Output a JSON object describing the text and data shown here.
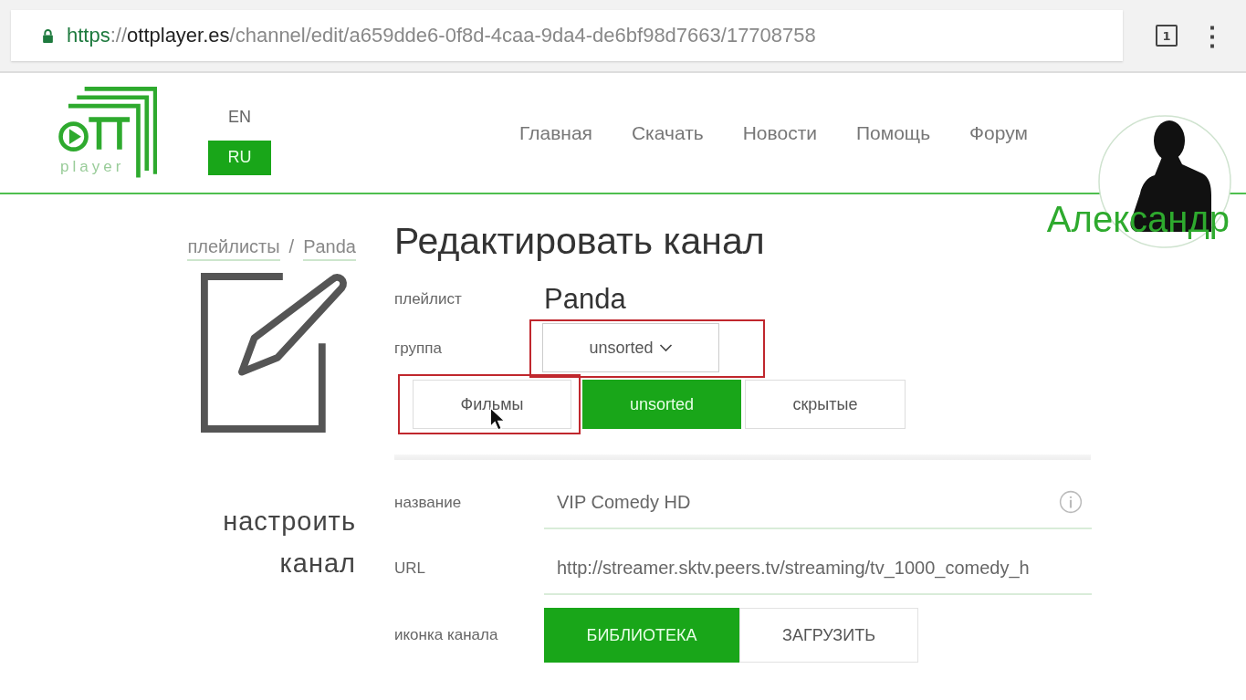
{
  "browser": {
    "url_scheme": "https",
    "url_sep": "://",
    "url_host": "ottplayer.es",
    "url_path": "/channel/edit/a659dde6-0f8d-4caa-9da4-de6bf98d7663/17708758",
    "tab_count": "1",
    "menu_glyph": "⋮"
  },
  "header": {
    "logo_text": "player",
    "languages": [
      {
        "label": "EN",
        "selected": false
      },
      {
        "label": "RU",
        "selected": true
      }
    ],
    "nav": [
      "Главная",
      "Скачать",
      "Новости",
      "Помощь",
      "Форум"
    ],
    "user_name": "Александр"
  },
  "breadcrumb": [
    "плейлисты",
    "Panda"
  ],
  "breadcrumb_sep": "/",
  "side_caption": [
    "настроить",
    "канал"
  ],
  "title": "Редактировать канал",
  "playlist": {
    "label": "плейлист",
    "value": "Panda"
  },
  "group": {
    "label": "группа",
    "value": "unsorted",
    "highlighted": true
  },
  "groups": [
    {
      "label": "Фильмы",
      "selected": false,
      "highlighted": true,
      "cursor": true
    },
    {
      "label": "unsorted",
      "selected": true,
      "highlighted": false,
      "cursor": false
    },
    {
      "label": "скрытые",
      "selected": false,
      "highlighted": false,
      "cursor": false
    }
  ],
  "fields": [
    {
      "label": "название",
      "value": "VIP Comedy HD",
      "info": true
    },
    {
      "label": "URL",
      "value": "http://streamer.sktv.peers.tv/streaming/tv_1000_comedy_h",
      "info": false
    }
  ],
  "icon_row": {
    "label": "иконка канала",
    "options": [
      {
        "label": "БИБЛИОТЕКА",
        "selected": true
      },
      {
        "label": "ЗАГРУЗИТЬ",
        "selected": false
      }
    ]
  }
}
